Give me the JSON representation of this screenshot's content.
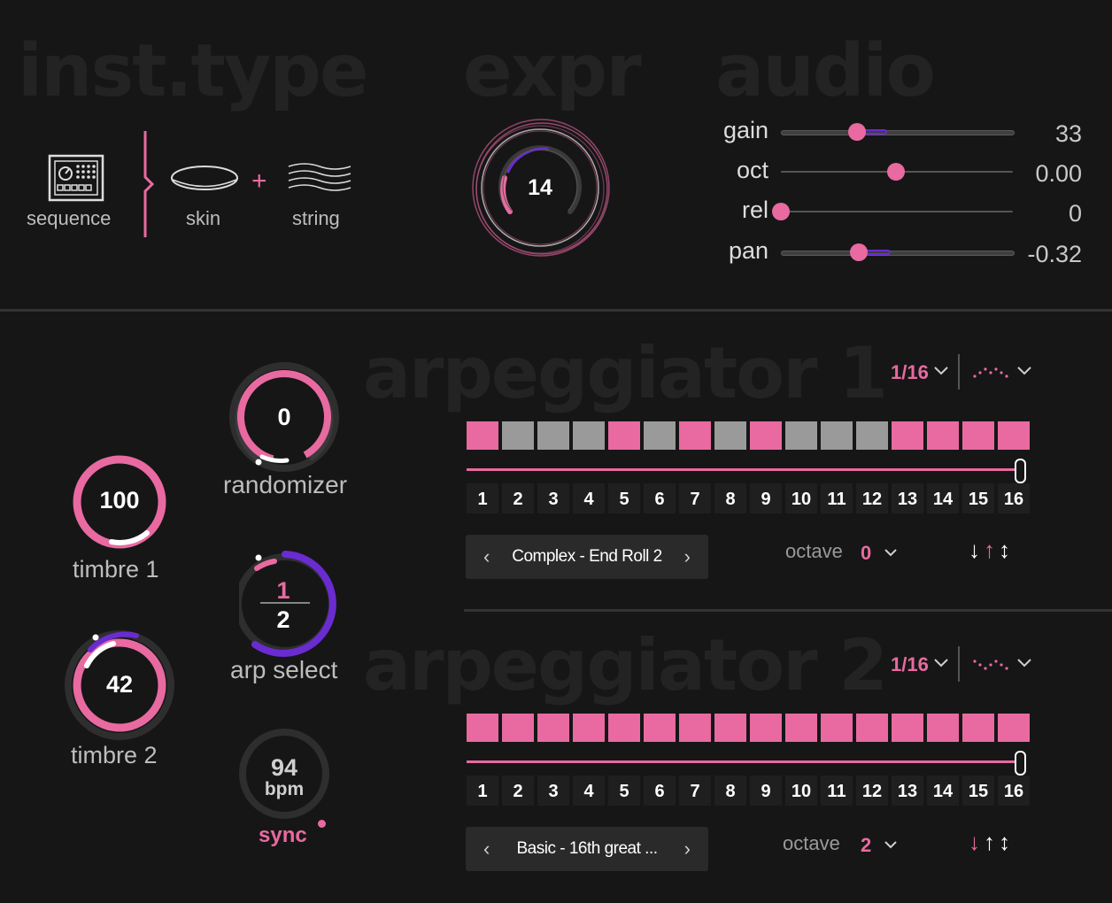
{
  "sections": {
    "inst_type": "inst.type",
    "expr": "expr",
    "audio": "audio",
    "arp1": "arpeggiator 1",
    "arp2": "arpeggiator 2"
  },
  "instrument": {
    "sequence_label": "sequence",
    "skin_label": "skin",
    "plus": "+",
    "string_label": "string",
    "icons": [
      "sequencer-icon",
      "skin-icon",
      "string-icon"
    ]
  },
  "expr": {
    "value": "14"
  },
  "audio": {
    "rows": [
      {
        "name": "gain",
        "value": "33",
        "level": 0.33
      },
      {
        "name": "oct",
        "value": "0.00",
        "level": 0.5
      },
      {
        "name": "rel",
        "value": "0",
        "level": 0.0
      },
      {
        "name": "pan",
        "value": "-0.32",
        "level": 0.34
      }
    ]
  },
  "knobs": {
    "randomizer": {
      "value": "0",
      "label": "randomizer"
    },
    "timbre1": {
      "value": "100",
      "label": "timbre 1"
    },
    "timbre2": {
      "value": "42",
      "label": "timbre 2"
    },
    "arp_select": {
      "top": "1",
      "bottom": "2",
      "label": "arp select"
    },
    "tempo": {
      "value": "94",
      "unit": "bpm",
      "sync": "sync"
    }
  },
  "arp1": {
    "rate": "1/16",
    "steps": [
      1,
      0,
      0,
      0,
      1,
      0,
      1,
      0,
      1,
      0,
      0,
      0,
      1,
      1,
      1,
      1
    ],
    "step_labels": [
      "1",
      "2",
      "3",
      "4",
      "5",
      "6",
      "7",
      "8",
      "9",
      "10",
      "11",
      "12",
      "13",
      "14",
      "15",
      "16"
    ],
    "preset": "Complex - End Roll 2",
    "octave_label": "octave",
    "octave_value": "0",
    "direction": [
      "↓",
      "↑",
      "↕"
    ],
    "active_direction": 1
  },
  "arp2": {
    "rate": "1/16",
    "steps": [
      1,
      1,
      1,
      1,
      1,
      1,
      1,
      1,
      1,
      1,
      1,
      1,
      1,
      1,
      1,
      1
    ],
    "step_labels": [
      "1",
      "2",
      "3",
      "4",
      "5",
      "6",
      "7",
      "8",
      "9",
      "10",
      "11",
      "12",
      "13",
      "14",
      "15",
      "16"
    ],
    "preset": "Basic - 16th great ...",
    "octave_label": "octave",
    "octave_value": "2",
    "direction": [
      "↓",
      "↑",
      "↕"
    ],
    "active_direction": 0
  },
  "nav": {
    "prev": "‹",
    "next": "›",
    "chevron": "⌄"
  },
  "colors": {
    "accent": "#e86aa0",
    "purple": "#6a2bd0",
    "bg": "#161616"
  }
}
